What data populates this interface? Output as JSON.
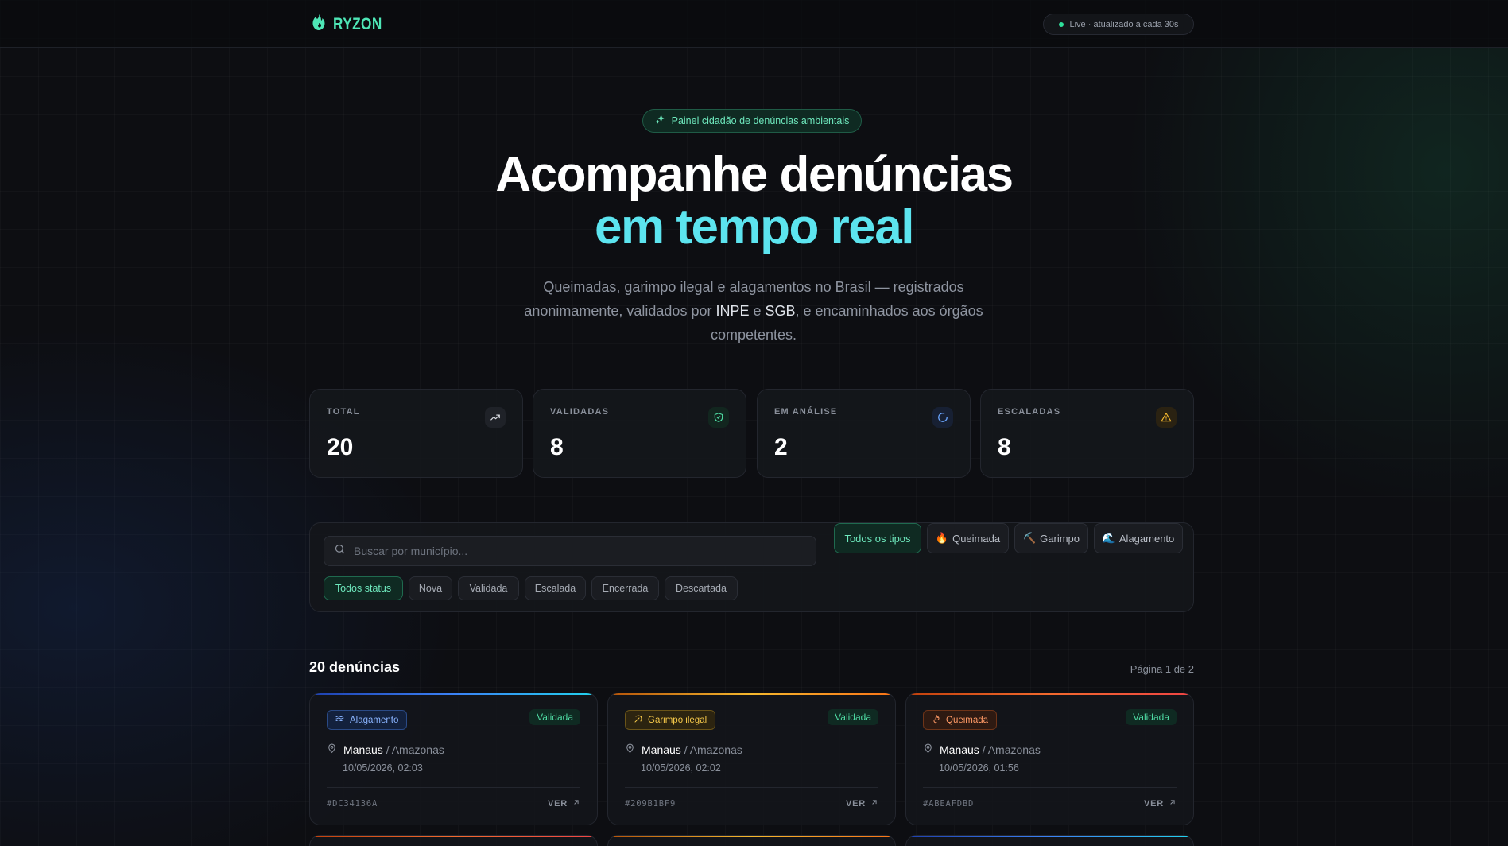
{
  "header": {
    "brand": "RYZON",
    "live_status": "Live · atualizado a cada 30s"
  },
  "hero": {
    "badge": "Painel cidadão de denúncias ambientais",
    "title_line1": "Acompanhe denúncias",
    "title_line2": "em tempo real",
    "subtitle_part1": "Queimadas, garimpo ilegal e alagamentos no Brasil — registrados anonimamente, validados por ",
    "subtitle_inpe": "INPE",
    "subtitle_and": " e ",
    "subtitle_sgb": "SGB",
    "subtitle_part2": ", e encaminhados aos órgãos competentes."
  },
  "stats": [
    {
      "label": "TOTAL",
      "value": "20",
      "icon": "trending-up-icon"
    },
    {
      "label": "VALIDADAS",
      "value": "8",
      "icon": "shield-check-icon"
    },
    {
      "label": "EM ANÁLISE",
      "value": "2",
      "icon": "loader-icon"
    },
    {
      "label": "ESCALADAS",
      "value": "8",
      "icon": "alert-triangle-icon"
    }
  ],
  "filters": {
    "search_placeholder": "Buscar por município...",
    "types": [
      {
        "label": "Todos os tipos",
        "emoji": "",
        "active": true
      },
      {
        "label": "Queimada",
        "emoji": "🔥",
        "active": false
      },
      {
        "label": "Garimpo",
        "emoji": "⛏️",
        "active": false
      },
      {
        "label": "Alagamento",
        "emoji": "🌊",
        "active": false
      }
    ],
    "statuses": [
      {
        "label": "Todos status",
        "active": true
      },
      {
        "label": "Nova",
        "active": false
      },
      {
        "label": "Validada",
        "active": false
      },
      {
        "label": "Escalada",
        "active": false
      },
      {
        "label": "Encerrada",
        "active": false
      },
      {
        "label": "Descartada",
        "active": false
      }
    ]
  },
  "results": {
    "count_label": "20 denúncias",
    "page_label": "Página 1 de 2"
  },
  "cards": [
    {
      "type": "Alagamento",
      "status": "Validada",
      "city": "Manaus",
      "state": "Amazonas",
      "date": "10/05/2026, 02:03",
      "id": "#DC34136A",
      "link": "VER"
    },
    {
      "type": "Garimpo ilegal",
      "status": "Validada",
      "city": "Manaus",
      "state": "Amazonas",
      "date": "10/05/2026, 02:02",
      "id": "#209B1BF9",
      "link": "VER"
    },
    {
      "type": "Queimada",
      "status": "Validada",
      "city": "Manaus",
      "state": "Amazonas",
      "date": "10/05/2026, 01:56",
      "id": "#ABEAFDBD",
      "link": "VER"
    }
  ],
  "colors": {
    "accent_green": "#4ee6b6",
    "accent_cyan": "#5ce4ef",
    "alagamento": "#3b82f6",
    "garimpo": "#f5b82e",
    "queimada": "#f26a2e",
    "status_validada": "#4fdca4",
    "alert": "#f5b82e"
  }
}
